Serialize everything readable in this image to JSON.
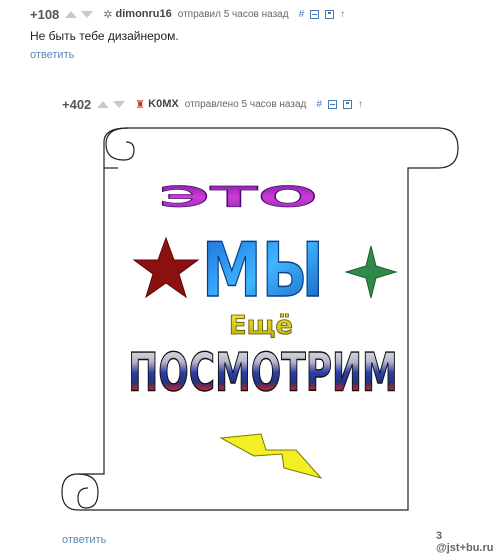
{
  "comment1": {
    "rating": "+108",
    "username": "dimonru16",
    "time": "отправил 5 часов назад",
    "text": "Не быть тебе дизайнером.",
    "reply_label": "ответить"
  },
  "comment2": {
    "rating": "+402",
    "username": "K0MX",
    "time": "отправлено 5 часов назад",
    "reply_label": "ответить",
    "image": {
      "line1": "ЭТО",
      "line2": "МЫ",
      "line3": "Ещё",
      "line4": "ПОСМОТРИМ"
    }
  },
  "icons": {
    "link": "#",
    "up_arrow": "↑"
  },
  "watermark": "3 @jst+bu.ru"
}
